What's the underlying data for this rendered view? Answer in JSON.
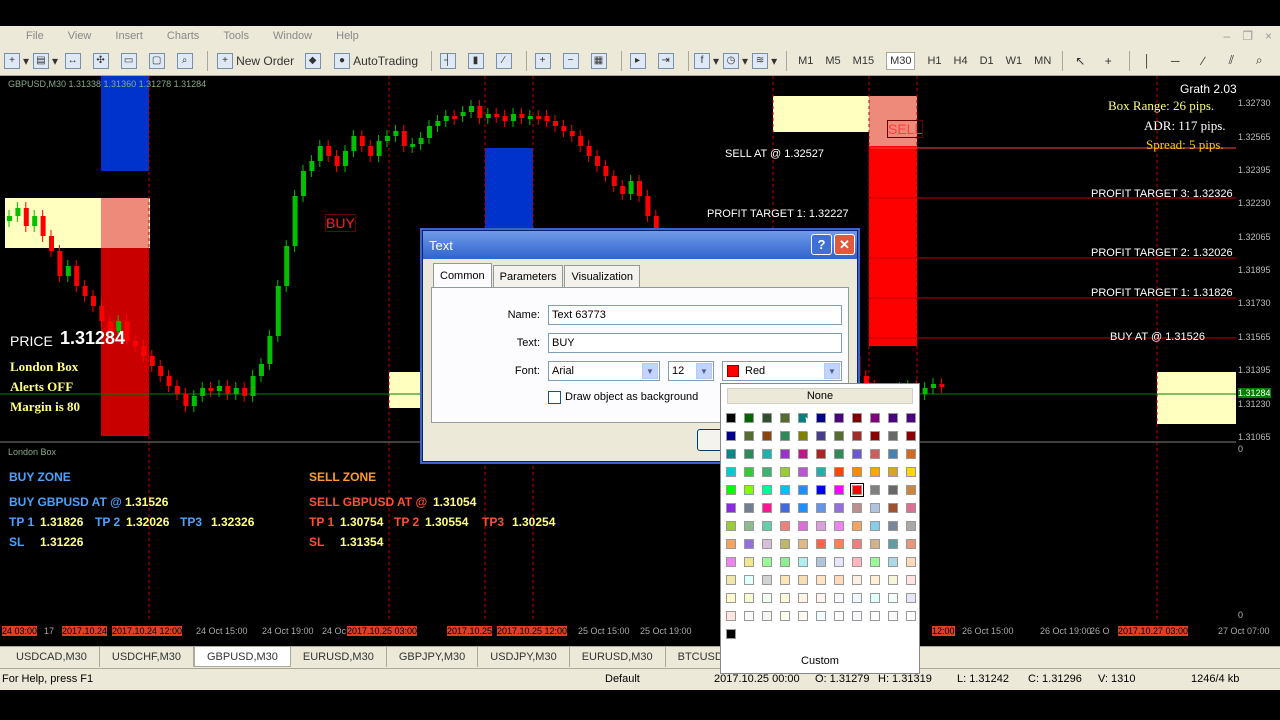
{
  "menu": [
    "File",
    "View",
    "Insert",
    "Charts",
    "Tools",
    "Window",
    "Help"
  ],
  "toolbar": {
    "new_order": "New Order",
    "autotrading": "AutoTrading",
    "timeframes": [
      "M1",
      "M5",
      "M15",
      "M30",
      "H1",
      "H4",
      "D1",
      "W1",
      "MN"
    ]
  },
  "chart": {
    "symbol_line": "GBPUSD,M30  1.31338 1.31360 1.31278 1.31284",
    "indicator_name": "Grath 2.03",
    "box_range": "Box Range: 26 pips.",
    "adr": "ADR: 117 pips.",
    "spread": "Spread: 5 pips.",
    "sell_at": "SELL AT @ 1.32527",
    "pt1_sell": "PROFIT TARGET 1: 1.32227",
    "pt3": "PROFIT TARGET 3: 1.32326",
    "pt2": "PROFIT TARGET 2: 1.32026",
    "pt1": "PROFIT TARGET 1: 1.31826",
    "buy_at": "BUY AT @ 1.31526",
    "buy_label": "BUY",
    "sell_label": "SELL",
    "price_label": "PRICE",
    "price_value": "1.31284",
    "london_box": "London Box",
    "alerts": "Alerts OFF",
    "margin": "Margin is 80",
    "subwindow_title": "London Box",
    "buy_zone": {
      "title": "BUY ZONE",
      "line1_label": "BUY GBPUSD AT @",
      "line1_value": "1.31526",
      "tp1_label": "TP 1",
      "tp1": "1.31826",
      "tp2_label": "TP 2",
      "tp2": "1.32026",
      "tp3_label": "TP3",
      "tp3": "1.32326",
      "sl_label": "SL",
      "sl": "1.31226"
    },
    "sell_zone": {
      "title": "SELL ZONE",
      "line1_label": "SELL GBPUSD AT @",
      "line1_value": "1.31054",
      "tp1_label": "TP 1",
      "tp1": "1.30754",
      "tp2_label": "TP 2",
      "tp2": "1.30554",
      "tp3_label": "TP3",
      "tp3": "1.30254",
      "sl_label": "SL",
      "sl": "1.31354"
    },
    "price_scale": [
      "1.32730",
      "1.32565",
      "1.32395",
      "1.32230",
      "1.32065",
      "1.31895",
      "1.31730",
      "1.31565",
      "1.31395",
      "1.31284",
      "1.31230",
      "1.31065",
      "0",
      "0"
    ],
    "time_axis": [
      {
        "text": "24 03:00",
        "hl": true
      },
      {
        "text": "17",
        "hl": false
      },
      {
        "text": "2017.10.24",
        "hl": true
      },
      {
        "text": "2017.10.24 12:00",
        "hl": true
      },
      {
        "text": "24 Oct 15:00",
        "hl": false
      },
      {
        "text": "24 Oct 19:00",
        "hl": false
      },
      {
        "text": "24 Oc",
        "hl": false
      },
      {
        "text": "2017.10.25 03:00",
        "hl": true
      },
      {
        "text": "2017.10.25",
        "hl": true
      },
      {
        "text": "2017.10.25 12:00",
        "hl": true
      },
      {
        "text": "25 Oct 15:00",
        "hl": false
      },
      {
        "text": "25 Oct 19:00",
        "hl": false
      },
      {
        "text": "12:00",
        "hl": true
      },
      {
        "text": "26 Oct 15:00",
        "hl": false
      },
      {
        "text": "26 Oct 19:00",
        "hl": false
      },
      {
        "text": "26 O",
        "hl": false
      },
      {
        "text": "2017.10.27 03:00",
        "hl": true
      },
      {
        "text": "27 Oct 07:00",
        "hl": false
      }
    ]
  },
  "tabs": [
    "USDCAD,M30",
    "USDCHF,M30",
    "GBPUSD,M30",
    "EURUSD,M30",
    "GBPJPY,M30",
    "USDJPY,M30",
    "EURUSD,M30",
    "BTCUSD,M1",
    "XAL",
    "30"
  ],
  "active_tab": 2,
  "status": {
    "help": "For Help, press F1",
    "profile": "Default",
    "datetime": "2017.10.25 00:00",
    "open": "O: 1.31279",
    "high": "H: 1.31319",
    "low": "L: 1.31242",
    "close": "C: 1.31296",
    "volume": "V: 1310",
    "traffic": "1246/4 kb"
  },
  "dialog": {
    "title": "Text",
    "tabs": [
      "Common",
      "Parameters",
      "Visualization"
    ],
    "name_label": "Name:",
    "name_value": "Text 63773",
    "text_label": "Text:",
    "text_value": "BUY",
    "font_label": "Font:",
    "font_value": "Arial",
    "size_value": "12",
    "color_value": "Red",
    "bg_checkbox": "Draw object as background"
  },
  "picker": {
    "none": "None",
    "custom": "Custom"
  },
  "colors": {
    "background": "#000000",
    "bull": "#00c000",
    "bear": "#ff0000",
    "sell_box": "#ff0000",
    "buy_box": "#0033cc",
    "range_box": "#ffffc0"
  }
}
